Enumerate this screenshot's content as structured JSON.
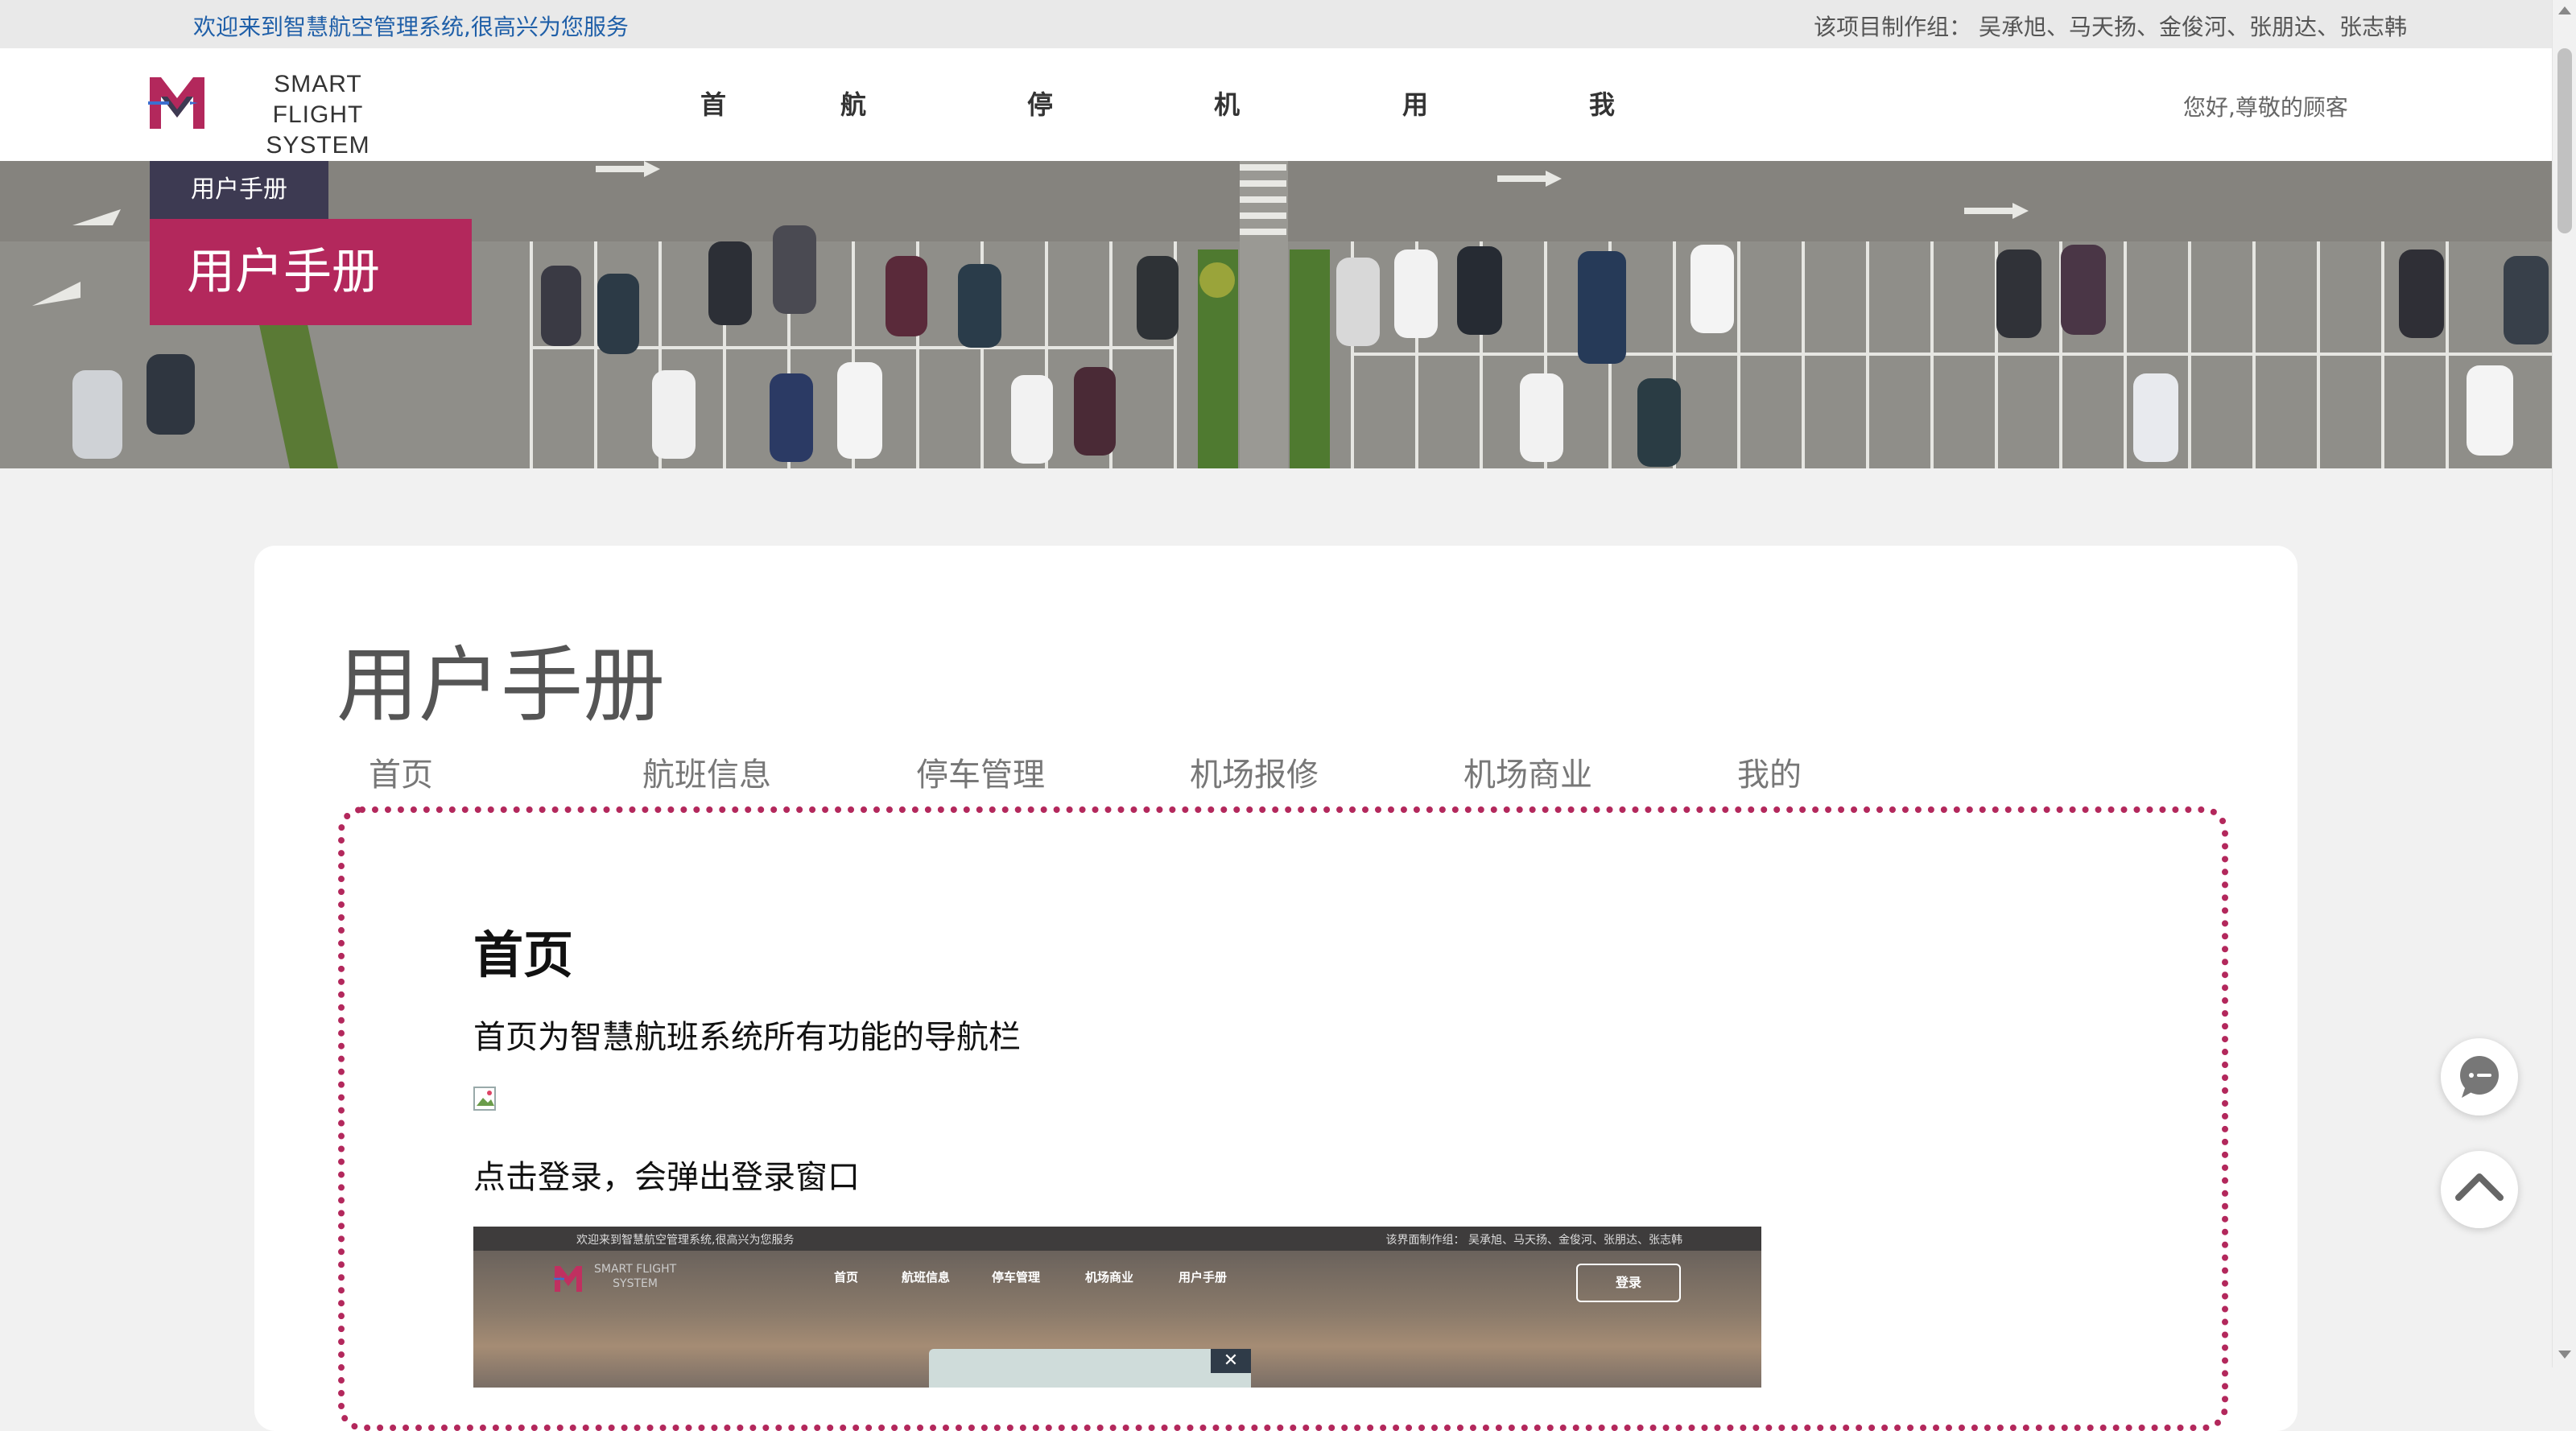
{
  "topbar": {
    "welcome": "欢迎来到智慧航空管理系统,很高兴为您服务",
    "credits": "该项目制作组：  吴承旭、马天扬、金俊河、张朋达、张志韩"
  },
  "header": {
    "logo_line1": "SMART FLIGHT",
    "logo_line2": "SYSTEM",
    "nav": [
      "首页",
      "航班信息",
      "停车管理",
      "机场商业",
      "用户手册",
      "我的"
    ],
    "greeting": "您好,尊敬的顾客"
  },
  "banner": {
    "crumb_small": "用户手册",
    "crumb_big": "用户手册"
  },
  "main": {
    "title": "用户手册",
    "tabs": [
      "首页",
      "航班信息",
      "停车管理",
      "机场报修",
      "机场商业",
      "我的"
    ],
    "section_title": "首页",
    "para1": "首页为智慧航班系统所有功能的导航栏",
    "para2": "点击登录，会弹出登录窗口"
  },
  "screenshot": {
    "welcome": "欢迎来到智慧航空管理系统,很高兴为您服务",
    "credits": "该界面制作组：  吴承旭、马天扬、金俊河、张朋达、张志韩",
    "logo_line1": "SMART FLIGHT",
    "logo_line2": "SYSTEM",
    "nav": [
      "首页",
      "航班信息",
      "停车管理",
      "机场商业",
      "用户手册"
    ],
    "login": "登录",
    "close": "✕"
  },
  "colors": {
    "accent": "#b3285c",
    "crumb_dark": "#3d3a52",
    "link_blue": "#1f5fa8"
  },
  "icons": {
    "chat": "chat-bubble-icon",
    "back_to_top": "chevron-up-icon"
  }
}
